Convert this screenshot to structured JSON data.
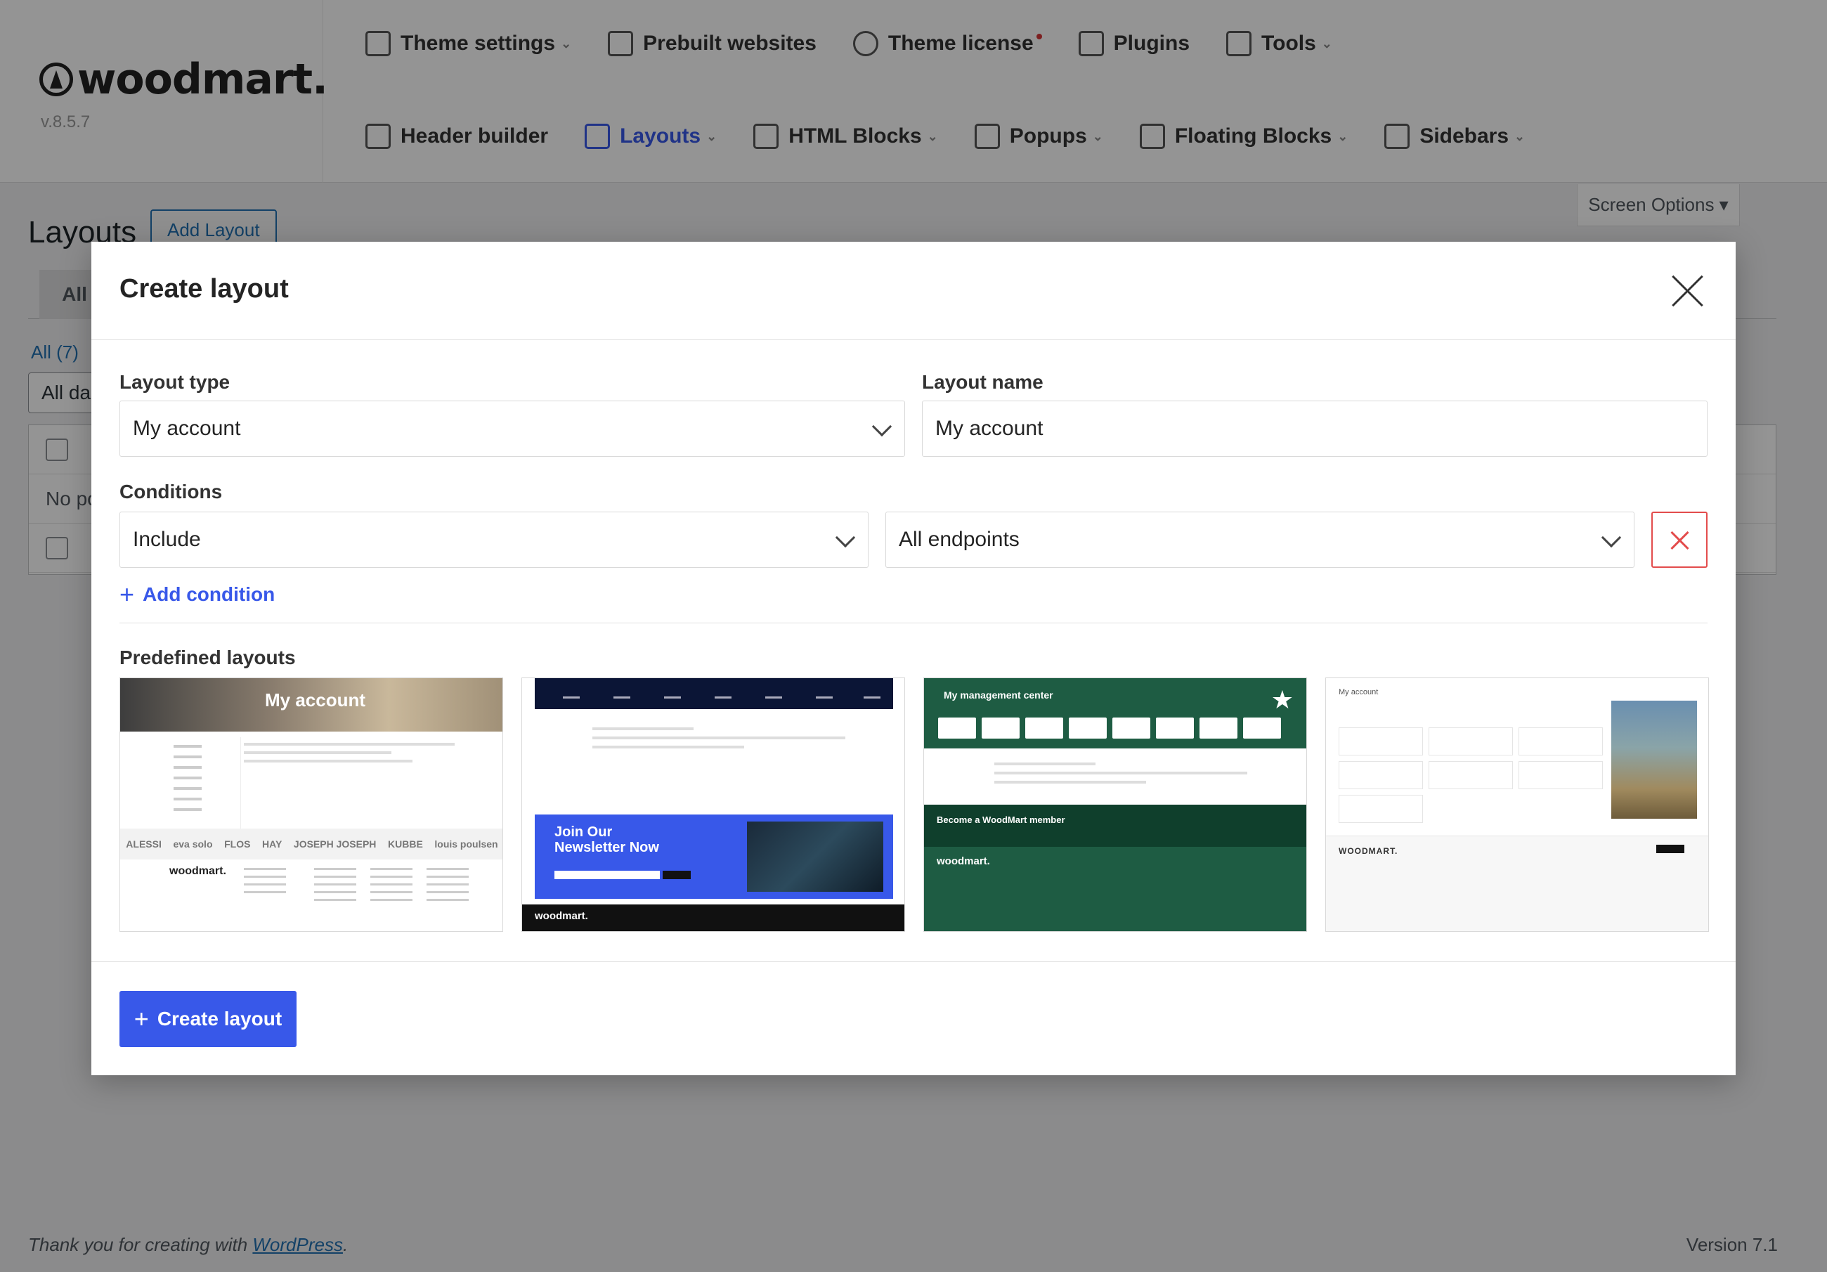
{
  "header": {
    "brand": "woodmart.",
    "version": "v.8.5.7",
    "nav_primary": [
      {
        "label": "Theme settings",
        "icon": "sliders-icon",
        "dropdown": true
      },
      {
        "label": "Prebuilt websites",
        "icon": "grid-icon",
        "dropdown": false
      },
      {
        "label": "Theme license",
        "icon": "key-icon",
        "dropdown": false,
        "badge": true
      },
      {
        "label": "Plugins",
        "icon": "puzzle-icon",
        "dropdown": false
      },
      {
        "label": "Tools",
        "icon": "wrench-icon",
        "dropdown": true
      }
    ],
    "nav_secondary": [
      {
        "label": "Header builder",
        "icon": "header-icon",
        "dropdown": false
      },
      {
        "label": "Layouts",
        "icon": "layers-icon",
        "dropdown": true,
        "active": true
      },
      {
        "label": "HTML Blocks",
        "icon": "code-icon",
        "dropdown": true
      },
      {
        "label": "Popups",
        "icon": "popup-icon",
        "dropdown": true
      },
      {
        "label": "Floating Blocks",
        "icon": "floating-icon",
        "dropdown": true
      },
      {
        "label": "Sidebars",
        "icon": "sidebar-icon",
        "dropdown": true
      }
    ],
    "screen_options": "Screen Options ▾"
  },
  "page": {
    "title": "Layouts",
    "add_button": "Add Layout",
    "tab_all": "All",
    "count": "All (7)",
    "filter": "All da",
    "rows": [
      "",
      "No po",
      ""
    ]
  },
  "modal": {
    "title": "Create layout",
    "layout_type_label": "Layout type",
    "layout_type_value": "My account",
    "layout_name_label": "Layout name",
    "layout_name_value": "My account",
    "conditions_label": "Conditions",
    "condition_type": "Include",
    "condition_value": "All endpoints",
    "add_condition": "Add condition",
    "predefined_label": "Predefined layouts",
    "create_button": "Create layout",
    "thumbs": {
      "t1_title": "My account",
      "t1_logo": "woodmart.",
      "t1_brands": [
        "ALESSI",
        "eva solo",
        "FLOS",
        "HAY",
        "JOSEPH JOSEPH",
        "KUBBE",
        "louis poulsen"
      ],
      "t2_news_title": "Join Our Newsletter Now",
      "t2_logo": "woodmart.",
      "t3_title": "My management center",
      "t3_member": "Become a WoodMart member",
      "t3_logo": "woodmart.",
      "t4_title": "My account",
      "t4_logo": "WOODMART."
    }
  },
  "footer": {
    "thanks_prefix": "Thank you for creating with ",
    "thanks_link": "WordPress",
    "thanks_suffix": ".",
    "version": "Version 7.1"
  },
  "colors": {
    "accent": "#3858e9",
    "danger": "#e34c4c",
    "wp_link": "#2271b1"
  }
}
